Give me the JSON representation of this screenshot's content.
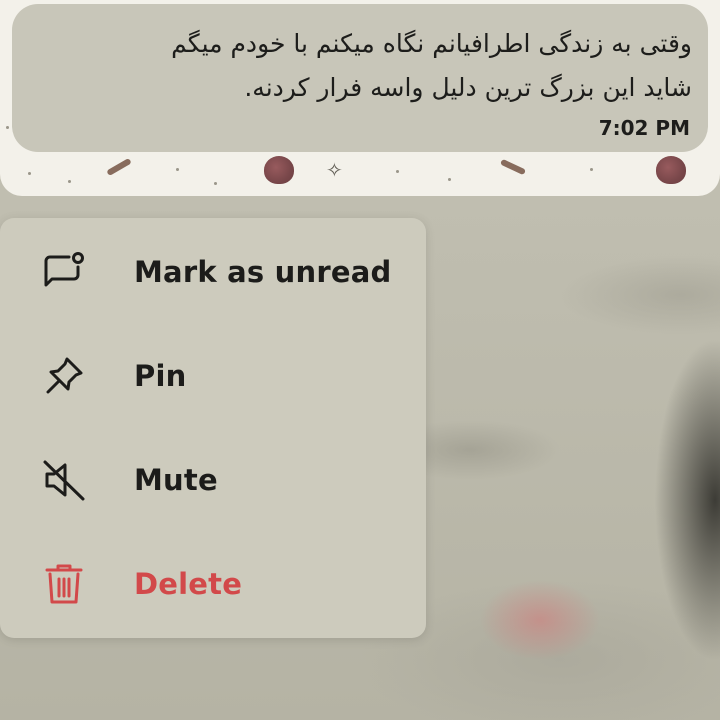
{
  "message": {
    "line1": "وقتی به زندگی اطرافیانم نگاه میکنم با خودم میگم",
    "line2": "شاید این بزرگ ترین دلیل واسه فرار کردنه.",
    "time": "7:02 PM"
  },
  "context_menu": {
    "items": [
      {
        "label": "Mark as unread",
        "icon": "chat-unread-icon"
      },
      {
        "label": "Pin",
        "icon": "pin-icon"
      },
      {
        "label": "Mute",
        "icon": "speaker-muted-icon"
      },
      {
        "label": "Delete",
        "icon": "trash-icon"
      }
    ]
  },
  "colors": {
    "danger": "#d2494a",
    "menu_background": "#cdcbbd",
    "bubble_background": "#c8c6b9",
    "text": "#1c1c1a"
  }
}
